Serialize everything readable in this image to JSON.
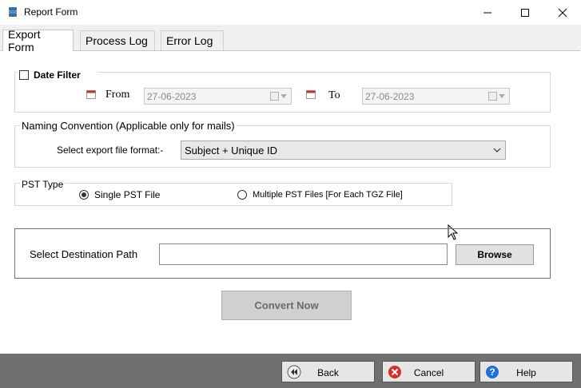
{
  "window": {
    "title": "Report Form"
  },
  "tabs": [
    {
      "label": "Export Form",
      "active": true
    },
    {
      "label": "Process Log"
    },
    {
      "label": "Error Log"
    }
  ],
  "date_filter": {
    "checkbox_label": "Date Filter",
    "checked": false,
    "from_label": "From",
    "from_value": "27-06-2023",
    "to_label": "To",
    "to_value": "27-06-2023"
  },
  "naming": {
    "legend": "Naming Convention (Applicable only for mails)",
    "select_label": "Select export file format:-",
    "selected": "Subject + Unique ID"
  },
  "pst_type": {
    "legend": "PST Type",
    "options": [
      "Single PST File",
      "Multiple PST Files [For Each TGZ File]"
    ],
    "selected_index": 0
  },
  "destination": {
    "label": "Select Destination Path",
    "value": "",
    "browse_label": "Browse"
  },
  "convert_label": "Convert Now",
  "footer": {
    "back_label": "Back",
    "cancel_label": "Cancel",
    "help_label": "Help"
  },
  "colors": {
    "accent": "#1e6fd9",
    "cancel_red": "#d32f2f",
    "bottom_bar": "#707070"
  }
}
